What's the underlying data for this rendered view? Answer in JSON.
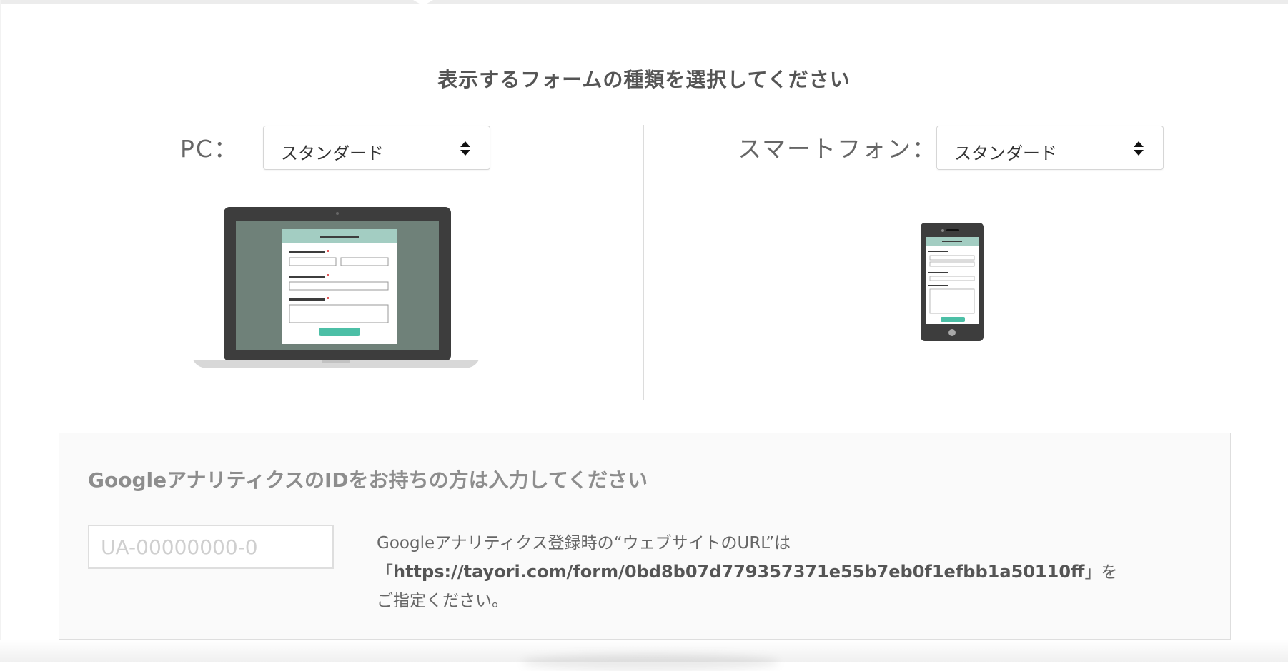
{
  "heading": "表示するフォームの種類を選択してください",
  "pc": {
    "label": "PC：",
    "selected": "スタンダード"
  },
  "smartphone": {
    "label": "スマートフォン：",
    "selected": "スタンダード"
  },
  "analytics": {
    "title": "GoogleアナリティクスのIDをお持ちの方は入力してください",
    "placeholder": "UA-00000000-0",
    "value": "",
    "note_line1": "Googleアナリティクス登録時の“ウェブサイトのURL”は",
    "note_open": "「",
    "url": "https://tayori.com/form/0bd8b07d779357371e55b7eb0f1efbb1a50110ff",
    "note_close": "」を",
    "note_line3": "ご指定ください。"
  },
  "colors": {
    "accent": "#4cbfa6",
    "preview_header": "#a3cdc2",
    "screen_bg": "#6f8179",
    "device_frame": "#3d3d3d"
  }
}
